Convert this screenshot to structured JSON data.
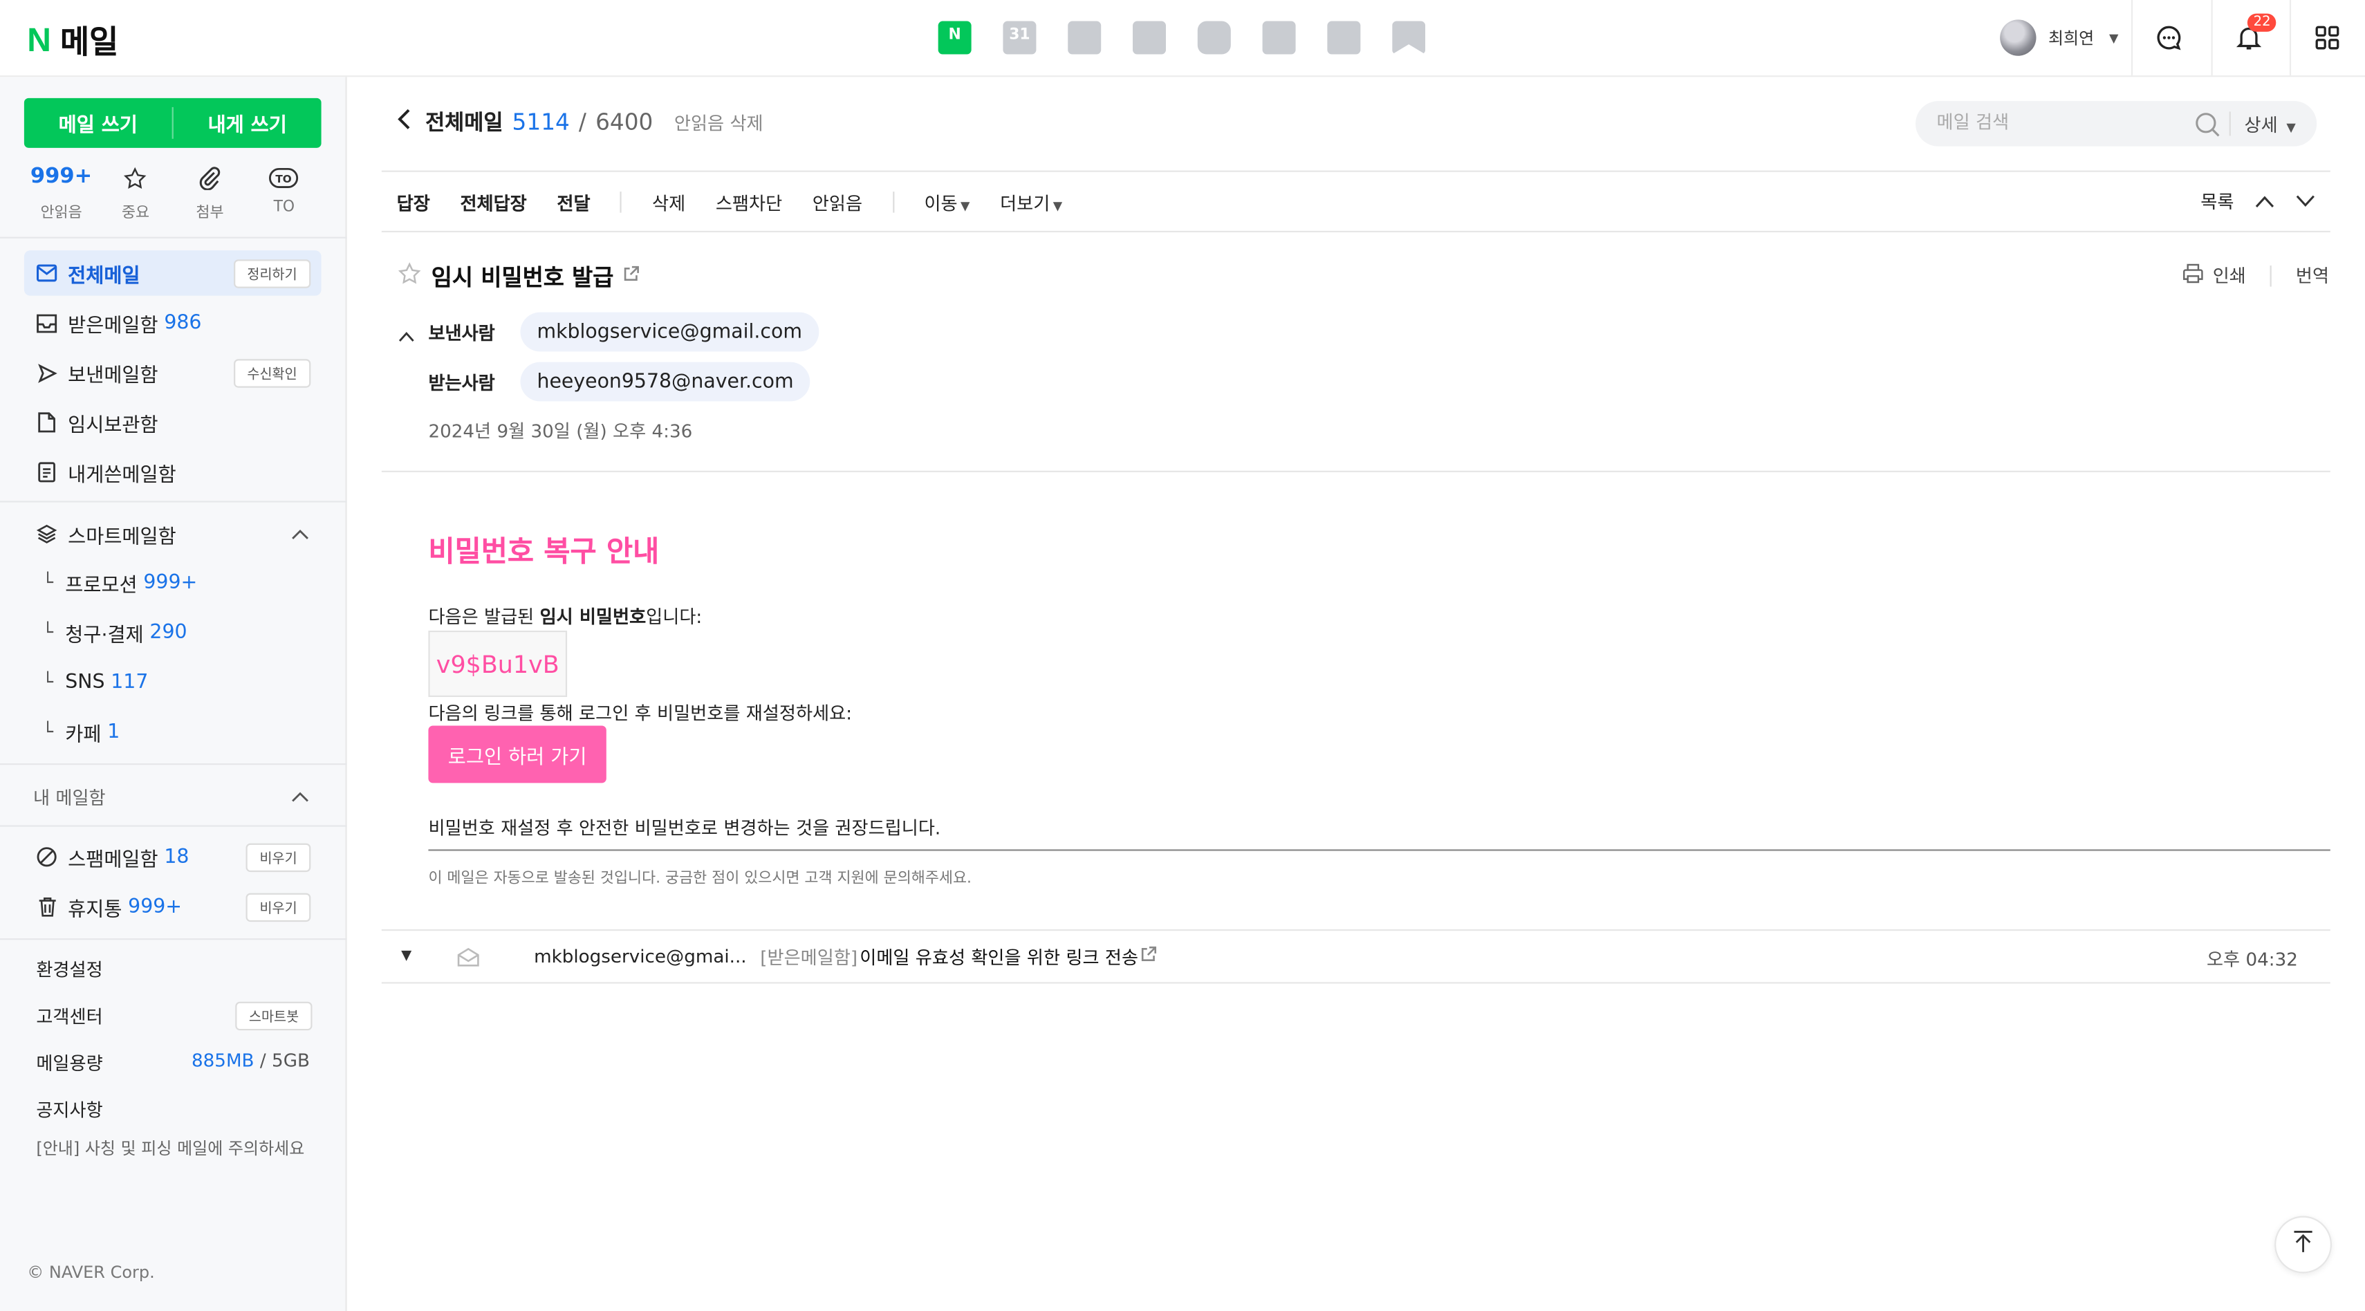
{
  "header": {
    "logo_letter": "N",
    "logo_text": "메일",
    "apps": [
      "mail-icon",
      "calendar-icon",
      "memo-icon",
      "contacts-icon",
      "mybox-icon",
      "todo-icon",
      "pay-icon",
      "bookmark-icon"
    ],
    "calendar_day": "31",
    "user_name": "최희연",
    "notification_count": "22",
    "accent": "#03c75a"
  },
  "sidebar": {
    "compose_label": "메일 쓰기",
    "self_compose_label": "내게 쓰기",
    "quick": [
      {
        "count": "999+",
        "label": "안읽음"
      },
      {
        "label": "중요"
      },
      {
        "label": "첨부"
      },
      {
        "label": "TO"
      }
    ],
    "folders": [
      {
        "label": "전체메일",
        "pill": "정리하기"
      },
      {
        "label": "받은메일함",
        "count": "986"
      },
      {
        "label": "보낸메일함",
        "pill": "수신확인"
      },
      {
        "label": "임시보관함"
      },
      {
        "label": "내게쓴메일함"
      }
    ],
    "smart": {
      "label": "스마트메일함",
      "items": [
        {
          "label": "프로모션",
          "count": "999+"
        },
        {
          "label": "청구·결제",
          "count": "290"
        },
        {
          "label": "SNS",
          "count": "117"
        },
        {
          "label": "카페",
          "count": "1"
        }
      ]
    },
    "my_mailbox_label": "내 메일함",
    "spam": {
      "label": "스팸메일함",
      "count": "18",
      "pill": "비우기"
    },
    "trash": {
      "label": "휴지통",
      "count": "999+",
      "pill": "비우기"
    },
    "settings_label": "환경설정",
    "support_label": "고객센터",
    "support_pill": "스마트봇",
    "storage_label": "메일용량",
    "storage_used": "885MB",
    "storage_sep": "/",
    "storage_total": "5GB",
    "notice_label": "공지사항",
    "notice_text": "[안내] 사칭 및 피싱 메일에 주의하세요",
    "copyright": "© NAVER Corp."
  },
  "main": {
    "mailbox_title": "전체메일",
    "unread_count": "5114",
    "separator": "/",
    "total_count": "6400",
    "delete_unread": "안읽음 삭제",
    "search_placeholder": "메일 검색",
    "search_detail": "상세",
    "toolbar": {
      "reply": "답장",
      "reply_all": "전체답장",
      "forward": "전달",
      "delete": "삭제",
      "block_spam": "스팸차단",
      "mark_unread": "안읽음",
      "move": "이동",
      "more": "더보기",
      "list": "목록"
    },
    "mail": {
      "subject": "임시 비밀번호 발급",
      "print": "인쇄",
      "translate": "번역",
      "from_label": "보낸사람",
      "from": "mkblogservice@gmail.com",
      "to_label": "받는사람",
      "to": "heeyeon9578@naver.com",
      "date": "2024년 9월 30일 (월) 오후 4:36"
    },
    "body": {
      "title": "비밀번호 복구 안내",
      "line1_prefix": "다음은 발급된 ",
      "line1_bold": "임시 비밀번호",
      "line1_suffix": "입니다:",
      "temp_password": "v9$Bu1vB",
      "line2": "다음의 링크를 통해 로그인 후 비밀번호를 재설정하세요:",
      "login_button": "로그인 하러 가기",
      "line3": "비밀번호 재설정 후 안전한 비밀번호로 변경하는 것을 권장드립니다.",
      "footnote": "이 메일은 자동으로 발송된 것입니다. 궁금한 점이 있으시면 고객 지원에 문의해주세요.",
      "accent": "#ff4ea3"
    },
    "thread": {
      "sender": "mkblogservice@gmai...",
      "folder": "[받은메일함]",
      "subject": "이메일 유효성 확인을 위한 링크 전송",
      "time": "오후 04:32"
    }
  }
}
